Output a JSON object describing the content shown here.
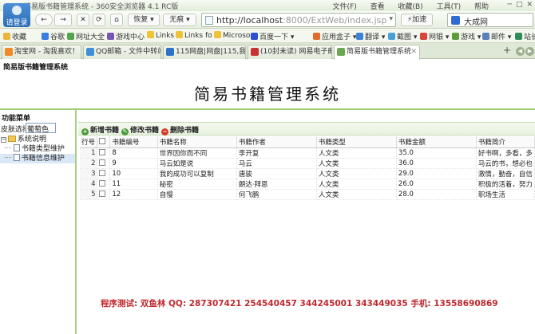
{
  "browser": {
    "window_title": "简易版书籍管理系统 - 360安全浏览器 4.1 RC版",
    "menus": [
      "文件(F)",
      "查看",
      "收藏(B)",
      "工具(T)",
      "帮助"
    ],
    "login_label": "请登录",
    "nav": {
      "back": "←",
      "forward": "→",
      "stop": "✕",
      "refresh": "⟳",
      "home": "⌂",
      "restore": "恢复",
      "no_image": "无痕"
    },
    "address": {
      "host": "http://localhost",
      "rest": ":8000/ExtWeb/index.jsp"
    },
    "speedup": "加速",
    "search_engine": "大成网",
    "favorites": [
      "收藏",
      "谷歌",
      "网址大全",
      "游戏中心",
      "Links",
      "Links fo",
      "Microso",
      "百度一下",
      "应用盒子",
      "翻译",
      "截图",
      "网银",
      "游戏",
      "邮件",
      "站长"
    ],
    "tabs": [
      {
        "label": "淘宝网 - 淘我喜欢！",
        "active": false,
        "color": "#f08a24"
      },
      {
        "label": "QQ邮箱 - 文件中转站",
        "active": false,
        "color": "#3f8fd6"
      },
      {
        "label": "115网盘|网盘|115,我的...",
        "active": false,
        "color": "#2d72c8"
      },
      {
        "label": "(10封未读) 网易电子邮...",
        "active": false,
        "color": "#c83232"
      },
      {
        "label": "简易版书籍管理系统",
        "active": true,
        "color": "#6aa84f"
      }
    ],
    "new_tab": "+"
  },
  "app": {
    "small_title": "简易版书籍管理系统",
    "main_title": "简易书籍管理系统",
    "menu_header": "功能菜单",
    "skin_label": "皮肤选择",
    "skin_value": "葡萄色",
    "tree": {
      "root": "系统说明",
      "items": [
        "书籍类型维护",
        "书籍信息维护"
      ]
    },
    "toolbar": {
      "add": "新增书籍",
      "edit": "修改书籍",
      "delete": "删除书籍"
    },
    "columns": [
      "行号",
      "",
      "书籍编号",
      "书籍名称",
      "书籍作者",
      "书籍类型",
      "书籍金额",
      "书籍简介"
    ],
    "rows": [
      {
        "no": "1",
        "id": "8",
        "name": "世界因你而不同",
        "author": "李开复",
        "type": "人文类",
        "price": "35.0",
        "desc": "好书啊，多看，多"
      },
      {
        "no": "2",
        "id": "9",
        "name": "马云如是说",
        "author": "马云",
        "type": "人文类",
        "price": "36.0",
        "desc": "马云的书，想必也"
      },
      {
        "no": "3",
        "id": "10",
        "name": "我的成功可以复制",
        "author": "唐骏",
        "type": "人文类",
        "price": "29.0",
        "desc": "激情，勤奋，自信"
      },
      {
        "no": "4",
        "id": "11",
        "name": "秘密",
        "author": "朗达·拜恩",
        "type": "人文类",
        "price": "26.0",
        "desc": "积极的活着，努力"
      },
      {
        "no": "5",
        "id": "12",
        "name": "自慢",
        "author": "何飞鹏",
        "type": "人文类",
        "price": "28.0",
        "desc": "职场生活"
      }
    ],
    "footer": "程序测试: 双鱼林     QQ: 287307421  254540457  344245001 343449035   手机: 13558690869"
  },
  "colors": {
    "accent_green": "#9ccc7a",
    "footer_red": "#c0272d"
  }
}
